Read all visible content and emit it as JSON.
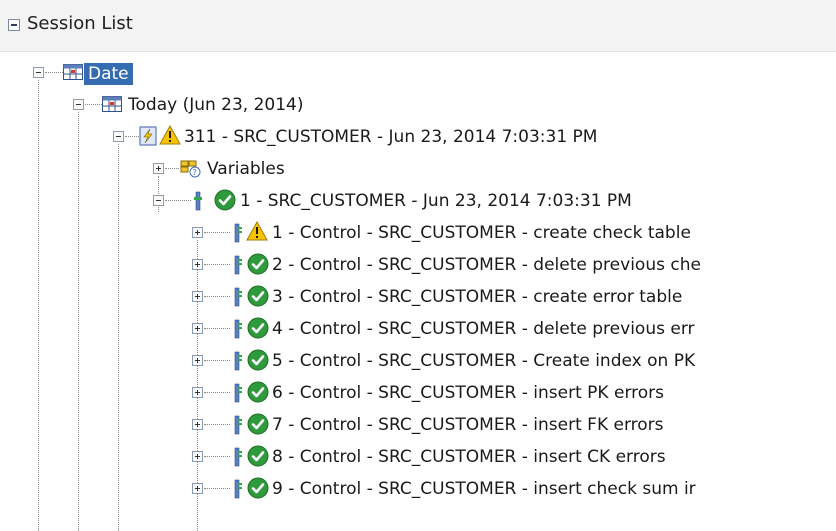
{
  "panel": {
    "title": "Session List"
  },
  "tree": {
    "root": {
      "label": "Date",
      "state": "expanded"
    },
    "day": {
      "label": "Today (Jun 23, 2014)",
      "state": "expanded"
    },
    "session": {
      "label": "311 - SRC_CUSTOMER - Jun 23, 2014 7:03:31 PM",
      "status": "warning",
      "state": "expanded"
    },
    "variables": {
      "label": "Variables",
      "state": "collapsed"
    },
    "step": {
      "label": "1 - SRC_CUSTOMER - Jun 23, 2014 7:03:31 PM",
      "status": "success",
      "state": "expanded"
    },
    "tasks": [
      {
        "label": "1 - Control - SRC_CUSTOMER - create check table",
        "status": "warning"
      },
      {
        "label": "2 - Control - SRC_CUSTOMER - delete previous che",
        "status": "success"
      },
      {
        "label": "3 - Control - SRC_CUSTOMER - create error table",
        "status": "success"
      },
      {
        "label": "4 - Control - SRC_CUSTOMER - delete previous err",
        "status": "success"
      },
      {
        "label": "5 - Control - SRC_CUSTOMER - Create index on PK",
        "status": "success"
      },
      {
        "label": "6 - Control - SRC_CUSTOMER - insert PK errors",
        "status": "success"
      },
      {
        "label": "7 - Control - SRC_CUSTOMER - insert FK errors",
        "status": "success"
      },
      {
        "label": "8 - Control - SRC_CUSTOMER - insert CK errors",
        "status": "success"
      },
      {
        "label": "9 - Control - SRC_CUSTOMER - insert check sum ir",
        "status": "success"
      }
    ]
  },
  "colors": {
    "selection": "#356cb1",
    "success": "#2e9a3c",
    "warning": "#f2b400"
  }
}
